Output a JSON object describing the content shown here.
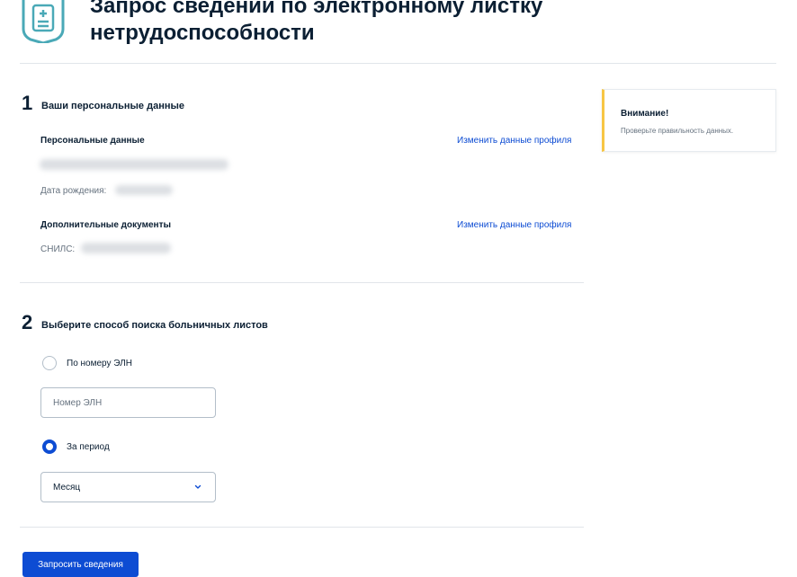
{
  "header": {
    "title": "Запрос сведений по электронному листку нетрудоспособности",
    "icon": "document-shield-icon",
    "accent_color": "#4aa9b7"
  },
  "step1": {
    "number": "1",
    "title": "Ваши персональные данные",
    "personal_label": "Персональные данные",
    "edit_link": "Изменить данные профиля",
    "birth_date_label": "Дата рождения:",
    "additional_docs_label": "Дополнительные документы",
    "edit_link_2": "Изменить данные профиля",
    "snils_label": "СНИЛС:"
  },
  "step2": {
    "number": "2",
    "title": "Выберите способ поиска больничных листов",
    "option_eln_label": "По номеру ЭЛН",
    "eln_placeholder": "Номер ЭЛН",
    "option_period_label": "За период",
    "period_selected": "Месяц"
  },
  "actions": {
    "submit_label": "Запросить сведения",
    "primary_color": "#0d4cd3"
  },
  "notice": {
    "title": "Внимание!",
    "text": "Проверьте правильность данных.",
    "accent_color": "#f7c644"
  }
}
